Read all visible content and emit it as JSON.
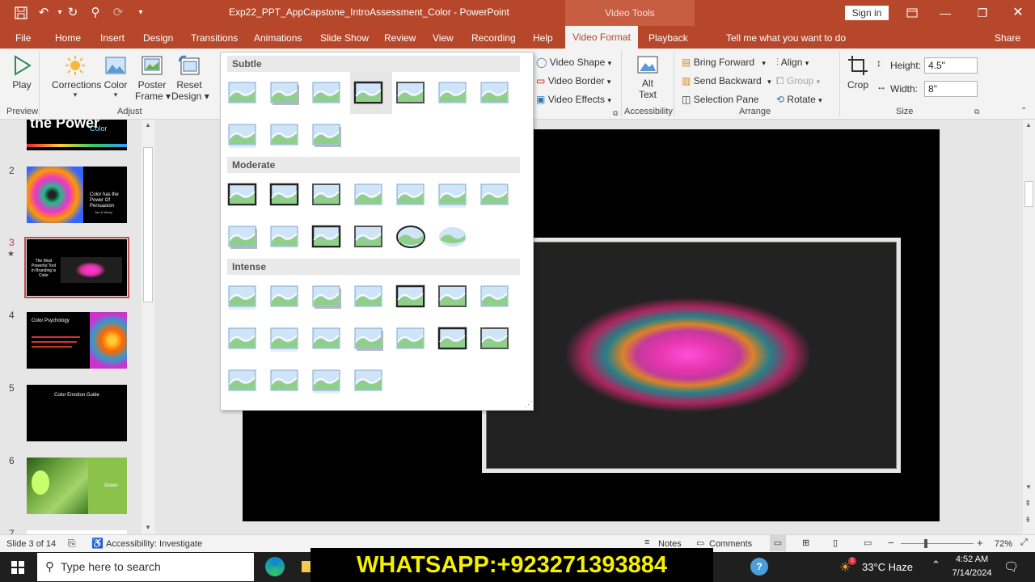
{
  "window": {
    "title": "Exp22_PPT_AppCapstone_IntroAssessment_Color  -  PowerPoint",
    "contextual_group": "Video Tools",
    "sign_in": "Sign in"
  },
  "tabs": [
    "File",
    "Home",
    "Insert",
    "Design",
    "Transitions",
    "Animations",
    "Slide Show",
    "Review",
    "View",
    "Recording",
    "Help",
    "Video Format",
    "Playback"
  ],
  "active_tab": "Video Format",
  "tell_me": "Tell me what you want to do",
  "share": "Share",
  "ribbon": {
    "play": "Play",
    "corrections": "Corrections",
    "color": "Color",
    "poster_frame_1": "Poster",
    "poster_frame_2": "Frame",
    "reset_design_1": "Reset",
    "reset_design_2": "Design",
    "group_preview": "Preview",
    "group_adjust": "Adjust",
    "video_shape": "Video Shape",
    "video_border": "Video Border",
    "video_effects": "Video Effects",
    "alt_text_1": "Alt",
    "alt_text_2": "Text",
    "group_accessibility": "Accessibility",
    "bring_forward": "Bring Forward",
    "send_backward": "Send Backward",
    "selection_pane": "Selection Pane",
    "align": "Align",
    "group": "Group",
    "rotate": "Rotate",
    "group_arrange": "Arrange",
    "crop": "Crop",
    "height_label": "Height:",
    "height_value": "4.5\"",
    "width_label": "Width:",
    "width_value": "8\"",
    "group_size": "Size"
  },
  "gallery": {
    "subtle": "Subtle",
    "moderate": "Moderate",
    "intense": "Intense"
  },
  "slides": {
    "numbers": [
      "2",
      "3",
      "4",
      "5",
      "6",
      "7"
    ],
    "thumb1_text": "Color",
    "thumb1_big": "the Power",
    "thumb2_text": "Color has the Power Of Persuasion",
    "thumb2_sub": "Jan & Wesly",
    "thumb3_text": "The Most Powerful Tool in Branding is Color",
    "thumb4_text": "Color Psychology",
    "thumb5_text": "Color Emotion Guide",
    "thumb6_text": "Green"
  },
  "status": {
    "slide_info": "Slide 3 of 14",
    "accessibility": "Accessibility: Investigate",
    "notes": "Notes",
    "comments": "Comments",
    "zoom": "72%"
  },
  "taskbar": {
    "search_placeholder": "Type here to search",
    "weather": "33°C  Haze",
    "time": "4:52 AM",
    "date": "7/14/2024",
    "weather_badge": "1"
  },
  "watermark": "WHATSAPP:+923271393884",
  "colors": {
    "accent": "#b7472a",
    "ribbon_bg": "#f3f3f3",
    "watermark_text": "#f4f000"
  }
}
